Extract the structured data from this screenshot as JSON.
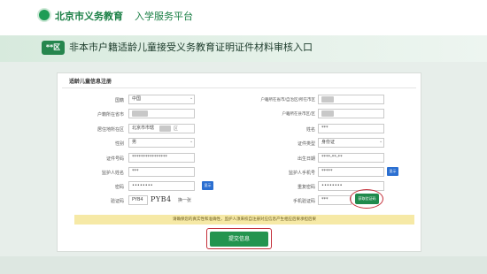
{
  "header": {
    "brand": "北京市义务教育",
    "subtitle": "入学服务平台"
  },
  "banner": {
    "district_badge": "**区",
    "title": "非本市户籍适龄儿童接受义务教育证明证件材料审核入口"
  },
  "form": {
    "section_title": "适龄儿童信息注册",
    "left": {
      "country_label": "国籍",
      "country_value": "中国",
      "household_label": "户籍所在省市",
      "residence_label": "居住地所在区",
      "residence_value": "北京市市辖",
      "residence_suffix": "区",
      "gender_label": "性别",
      "gender_value": "男",
      "id_label": "证件号码",
      "id_value": "****************",
      "guardian_name_label": "监护人姓名",
      "guardian_name_value": "***",
      "password_label": "密码",
      "password_value": "••••••••",
      "captcha_label": "验证码",
      "captcha_input": "PYB4",
      "captcha_image": "PYB4",
      "captcha_refresh": "换一张"
    },
    "right": {
      "household_district_label": "户籍所在省市/自治区/所在市区",
      "household_district_label2": "户籍所在县市区/区",
      "name_label": "姓名",
      "name_value": "***",
      "id_type_label": "证件类型",
      "id_type_value": "身份证",
      "birth_label": "出生日期",
      "birth_value": "****-**-**",
      "guardian_id_label": "监护人手机号",
      "guardian_id_value": "*****",
      "confirm_password_label": "重复密码",
      "confirm_password_value": "••••••••",
      "sms_label": "手机验证码",
      "sms_value": "***",
      "sms_button": "获取验证码"
    },
    "mini_button": "显示",
    "notice": "请确保您的真实性和准确性，监护人须来校自注册对应信息产生相应后果承担后果",
    "submit": "提交信息"
  }
}
